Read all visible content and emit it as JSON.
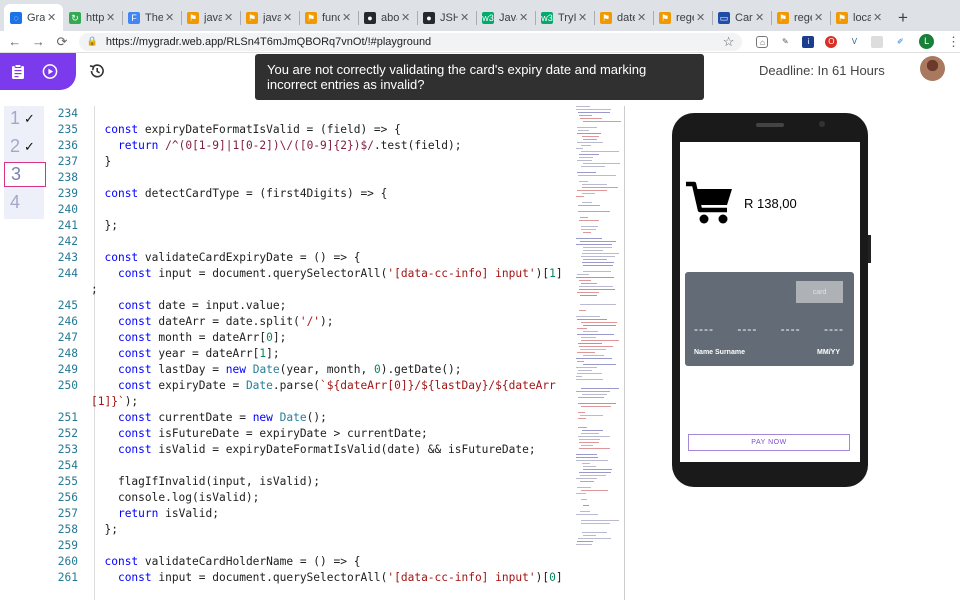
{
  "browser": {
    "tabs": [
      {
        "title": "Grad",
        "icon": "gradr-icon",
        "color": "#1a73e8",
        "glyph": "◌",
        "active": true
      },
      {
        "title": "http",
        "icon": "refresh-green-icon",
        "color": "#34a853",
        "glyph": "↻",
        "active": false
      },
      {
        "title": "The",
        "icon": "f-blue-icon",
        "color": "#4285f4",
        "glyph": "F",
        "active": false
      },
      {
        "title": "javas",
        "icon": "bookmark-icon",
        "color": "#f29900",
        "glyph": "⚑",
        "active": false
      },
      {
        "title": "javas",
        "icon": "bookmark-icon",
        "color": "#f29900",
        "glyph": "⚑",
        "active": false
      },
      {
        "title": "func",
        "icon": "bookmark-icon",
        "color": "#f29900",
        "glyph": "⚑",
        "active": false
      },
      {
        "title": "abou",
        "icon": "github-icon",
        "color": "#24292e",
        "glyph": "●",
        "active": false
      },
      {
        "title": "JSH",
        "icon": "github-icon",
        "color": "#24292e",
        "glyph": "●",
        "active": false
      },
      {
        "title": "Java",
        "icon": "w3-icon",
        "color": "#04aa6d",
        "glyph": "w3",
        "active": false
      },
      {
        "title": "TryIt",
        "icon": "w3-icon",
        "color": "#04aa6d",
        "glyph": "w3",
        "active": false
      },
      {
        "title": "date",
        "icon": "bookmark-icon",
        "color": "#f29900",
        "glyph": "⚑",
        "active": false
      },
      {
        "title": "rege",
        "icon": "bookmark-icon",
        "color": "#f29900",
        "glyph": "⚑",
        "active": false
      },
      {
        "title": "Card",
        "icon": "card-icon",
        "color": "#1f4ea8",
        "glyph": "▭",
        "active": false
      },
      {
        "title": "rege",
        "icon": "bookmark-icon",
        "color": "#f29900",
        "glyph": "⚑",
        "active": false
      },
      {
        "title": "loca",
        "icon": "bookmark-icon",
        "color": "#f29900",
        "glyph": "⚑",
        "active": false
      }
    ],
    "url": "https://mygradr.web.app/RLSn4T6mJmQBORq7vnOt/!#playground",
    "profile_initial": "L"
  },
  "app": {
    "toast": "You are not correctly validating the card's expiry date and marking incorrect entries as invalid?",
    "deadline": "Deadline: In 61 Hours",
    "steps": [
      {
        "num": "1",
        "done": true,
        "current": false
      },
      {
        "num": "2",
        "done": true,
        "current": false
      },
      {
        "num": "3",
        "done": false,
        "current": true
      },
      {
        "num": "4",
        "done": false,
        "current": false
      }
    ],
    "check_glyph": "✓"
  },
  "editor": {
    "lines": [
      {
        "n": "234",
        "code": ""
      },
      {
        "n": "235",
        "code": "  <k>const</k> expiryDateFormatIsValid = (field) => {"
      },
      {
        "n": "236",
        "code": "    <k>return</k> <r>/^(0[1-9]|1[0-2])\\/([0-9]{2})$/</r>.test(field);"
      },
      {
        "n": "237",
        "code": "  }"
      },
      {
        "n": "238",
        "code": ""
      },
      {
        "n": "239",
        "code": "  <k>const</k> detectCardType = (first4Digits) => {"
      },
      {
        "n": "240",
        "code": ""
      },
      {
        "n": "241",
        "code": "  };"
      },
      {
        "n": "242",
        "code": ""
      },
      {
        "n": "243",
        "code": "  <k>const</k> validateCardExpiryDate = () => {"
      },
      {
        "n": "244",
        "code": "    <k>const</k> input = document.querySelectorAll(<s>'[data-cc-info] input'</s>)[<d>1</d>]"
      },
      {
        "n": "",
        "code": ";",
        "wrap": true
      },
      {
        "n": "245",
        "code": "    <k>const</k> date = input.value;"
      },
      {
        "n": "246",
        "code": "    <k>const</k> dateArr = date.split(<s>'/'</s>);"
      },
      {
        "n": "247",
        "code": "    <k>const</k> month = dateArr[<d>0</d>];"
      },
      {
        "n": "248",
        "code": "    <k>const</k> year = dateArr[<d>1</d>];"
      },
      {
        "n": "249",
        "code": "    <k>const</k> lastDay = <k>new</k> <t>Date</t>(year, month, <d>0</d>).getDate();"
      },
      {
        "n": "250",
        "code": "    <k>const</k> expiryDate = <t>Date</t>.parse(<s>`${dateArr[0]}/${lastDay}/${dateArr</s>"
      },
      {
        "n": "",
        "code": "<s>[1]}`</s>);",
        "wrap": true
      },
      {
        "n": "251",
        "code": "    <k>const</k> currentDate = <k>new</k> <t>Date</t>();"
      },
      {
        "n": "252",
        "code": "    <k>const</k> isFutureDate = expiryDate > currentDate;"
      },
      {
        "n": "253",
        "code": "    <k>const</k> isValid = expiryDateFormatIsValid(date) && isFutureDate;"
      },
      {
        "n": "254",
        "code": ""
      },
      {
        "n": "255",
        "code": "    flagIfInvalid(input, isValid);"
      },
      {
        "n": "256",
        "code": "    console.log(isValid);"
      },
      {
        "n": "257",
        "code": "    <k>return</k> isValid;"
      },
      {
        "n": "258",
        "code": "  };"
      },
      {
        "n": "259",
        "code": ""
      },
      {
        "n": "260",
        "code": "  <k>const</k> validateCardHolderName = () => {"
      },
      {
        "n": "261",
        "code": "    <k>const</k> input = document.querySelectorAll(<s>'[data-cc-info] input'</s>)[<d>0</d>]"
      }
    ]
  },
  "preview": {
    "amount": "R 138,00",
    "card_chip_label": "card",
    "card_number_groups": [
      "----",
      "----",
      "----",
      "----"
    ],
    "card_name": "Name Surname",
    "card_expiry": "MM/YY",
    "pay_button": "PAY NOW"
  },
  "colors": {
    "brand_purple": "#7c3aed",
    "card_bg": "#636b76"
  }
}
